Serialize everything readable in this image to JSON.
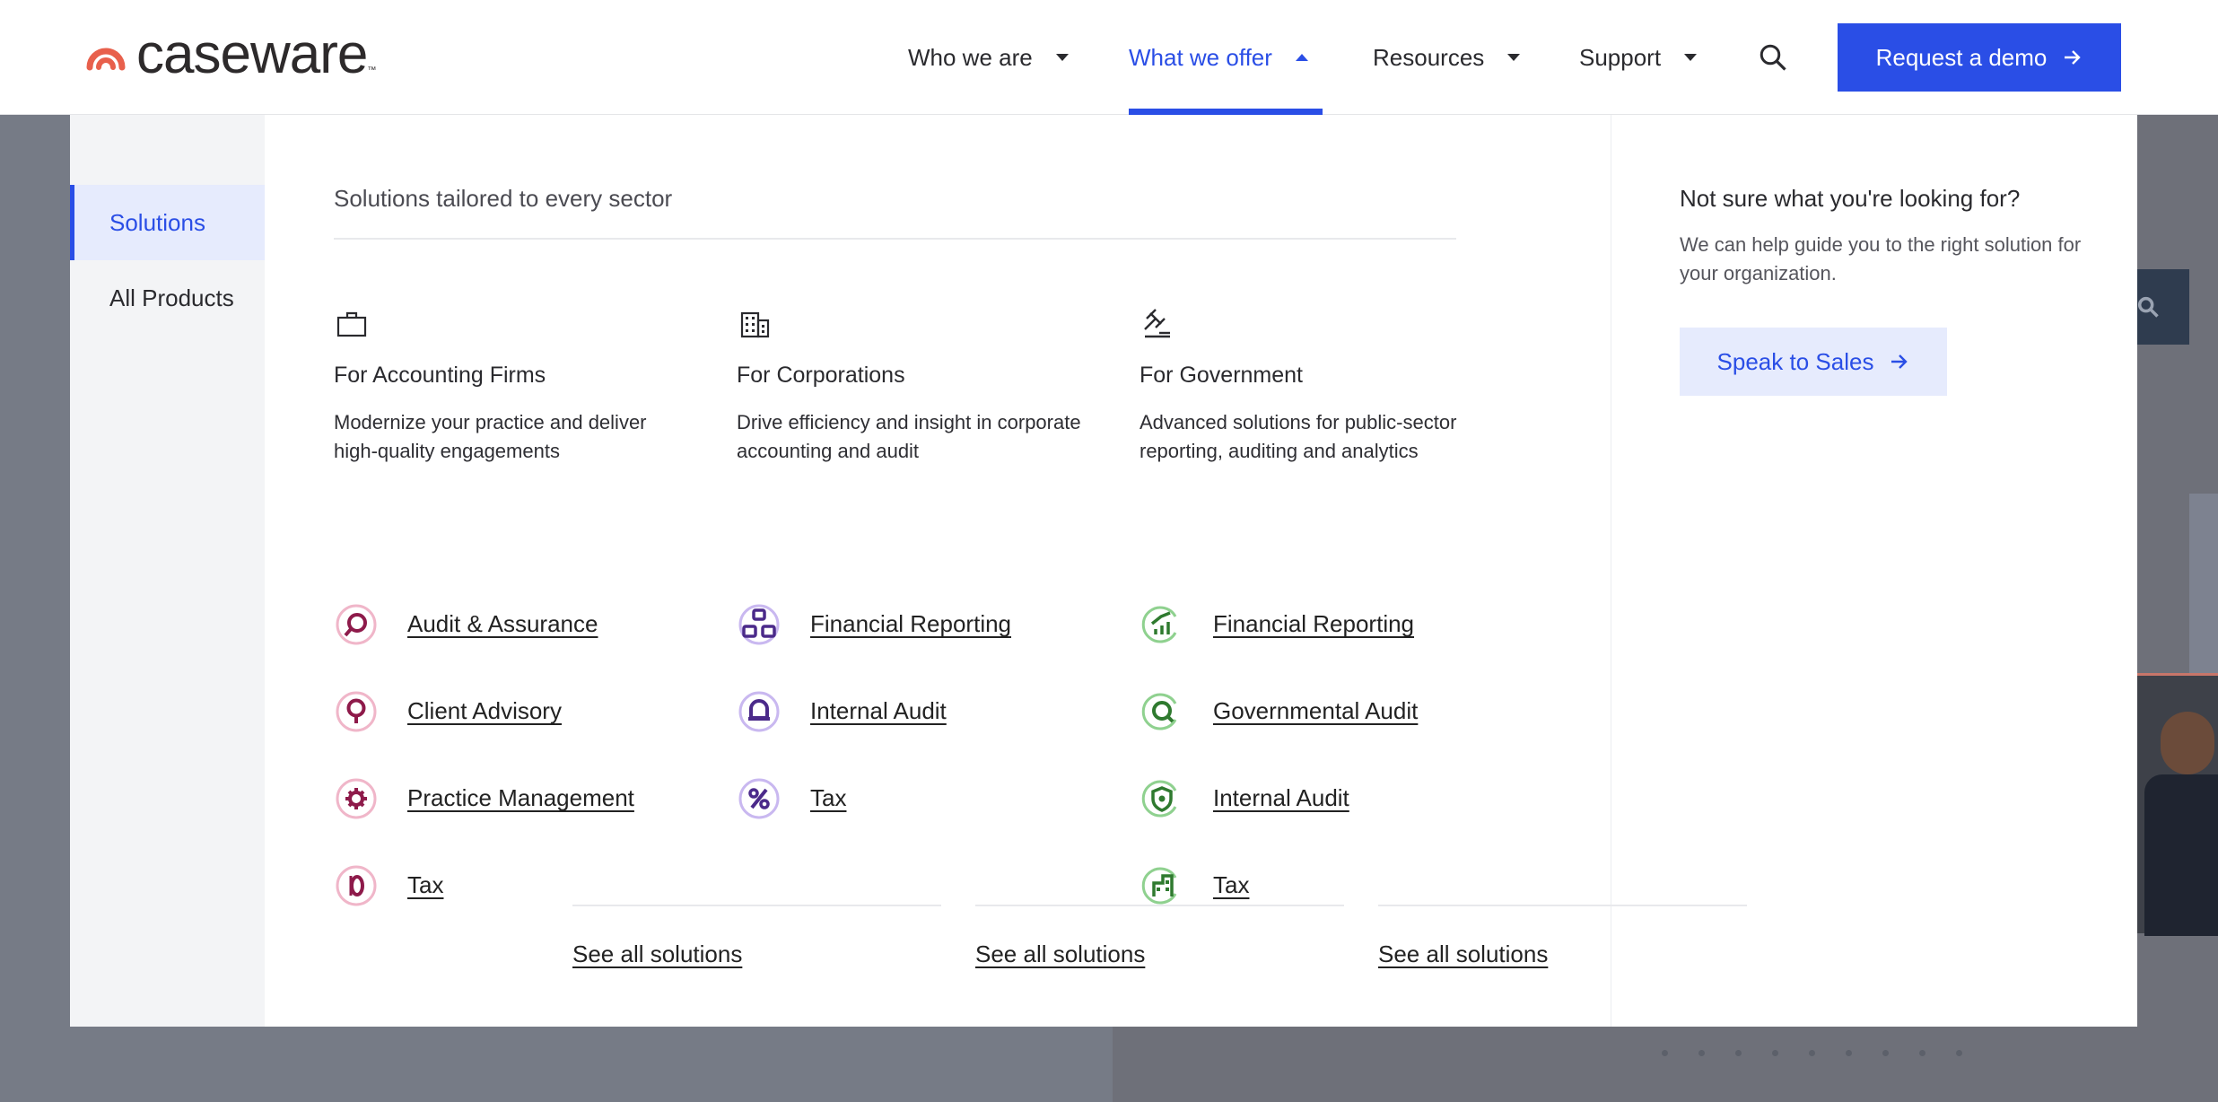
{
  "brand": {
    "name": "caseware",
    "tm": "™",
    "accent": "#2a4ee6",
    "logo_color": "#e8604c"
  },
  "nav": {
    "items": [
      {
        "label": "Who we are"
      },
      {
        "label": "What we offer"
      },
      {
        "label": "Resources"
      },
      {
        "label": "Support"
      }
    ],
    "cta": "Request a demo"
  },
  "menu": {
    "sidebar": [
      {
        "label": "Solutions"
      },
      {
        "label": "All Products"
      }
    ],
    "heading": "Solutions tailored to every sector",
    "columns": [
      {
        "icon": "briefcase-icon",
        "title": "For Accounting Firms",
        "description": "Modernize your practice and deliver high-quality engagements",
        "links": [
          {
            "label": "Audit & Assurance",
            "icon": "magnifier-icon"
          },
          {
            "label": "Client Advisory",
            "icon": "lightbulb-icon"
          },
          {
            "label": "Practice Management",
            "icon": "cog-icon"
          },
          {
            "label": "Tax",
            "icon": "zero-icon"
          }
        ],
        "see_all": "See all solutions",
        "color": "#8e1a4a"
      },
      {
        "icon": "building-icon",
        "title": "For Corporations",
        "description": "Drive efficiency and insight in corporate accounting and audit",
        "links": [
          {
            "label": "Financial Reporting",
            "icon": "org-chart-icon"
          },
          {
            "label": "Internal Audit",
            "icon": "bell-icon"
          },
          {
            "label": "Tax",
            "icon": "percent-icon"
          }
        ],
        "see_all": "See all solutions",
        "color": "#4b2a8a"
      },
      {
        "icon": "gavel-icon",
        "title": "For Government",
        "description": "Advanced solutions for public-sector reporting, auditing and analytics",
        "links": [
          {
            "label": "Financial Reporting",
            "icon": "growth-chart-icon"
          },
          {
            "label": "Governmental Audit",
            "icon": "magnifier-icon"
          },
          {
            "label": "Internal Audit",
            "icon": "shield-icon"
          },
          {
            "label": "Tax",
            "icon": "building-icon"
          }
        ],
        "see_all": "See all solutions",
        "color": "#2f7a2f"
      }
    ],
    "help": {
      "title": "Not sure what you're looking for?",
      "description": "We can help guide you to the right solution for your organization.",
      "button": "Speak to Sales"
    }
  }
}
